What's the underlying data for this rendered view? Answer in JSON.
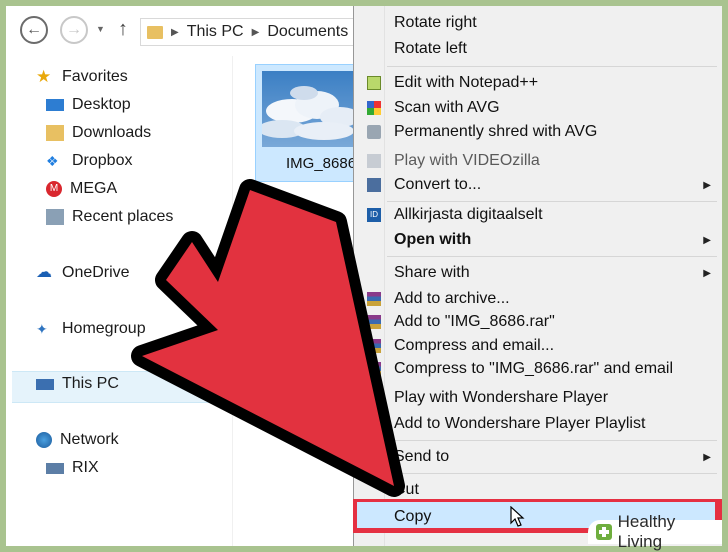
{
  "toolbar": {
    "back_icon": "back-arrow-icon",
    "forward_icon": "forward-arrow-icon",
    "breadcrumb": [
      "This PC",
      "Documents"
    ]
  },
  "nav": {
    "favorites": "Favorites",
    "desktop": "Desktop",
    "downloads": "Downloads",
    "dropbox": "Dropbox",
    "mega": "MEGA",
    "recent": "Recent places",
    "onedrive": "OneDrive",
    "homegroup": "Homegroup",
    "thispc": "This PC",
    "network": "Network",
    "rix": "RIX"
  },
  "file": {
    "name": "IMG_8686"
  },
  "menu": {
    "items": [
      {
        "label": "Rotate right"
      },
      {
        "label": "Rotate left"
      },
      {
        "label": "Edit with Notepad++"
      },
      {
        "label": "Scan with AVG"
      },
      {
        "label": "Permanently shred with AVG"
      },
      {
        "label": "Play with VIDEOzilla"
      },
      {
        "label": "Convert to..."
      },
      {
        "label": "Allkirjasta digitaalselt"
      },
      {
        "label": "Open with"
      },
      {
        "label": "Share with"
      },
      {
        "label": "Add to archive..."
      },
      {
        "label": "Add to \"IMG_8686.rar\""
      },
      {
        "label": "Compress and email..."
      },
      {
        "label": "Compress to \"IMG_8686.rar\" and email"
      },
      {
        "label": "Play with Wondershare Player"
      },
      {
        "label": "Add to Wondershare Player Playlist"
      },
      {
        "label": "Send to"
      },
      {
        "label": "Cut"
      },
      {
        "label": "Copy"
      }
    ]
  },
  "watermark": {
    "text": "Healthy Living"
  },
  "colors": {
    "highlight_red": "#e53042",
    "selection_blue": "#cce8ff",
    "menu_bg": "#f0f0f0",
    "frame_green": "#a9c38f"
  }
}
